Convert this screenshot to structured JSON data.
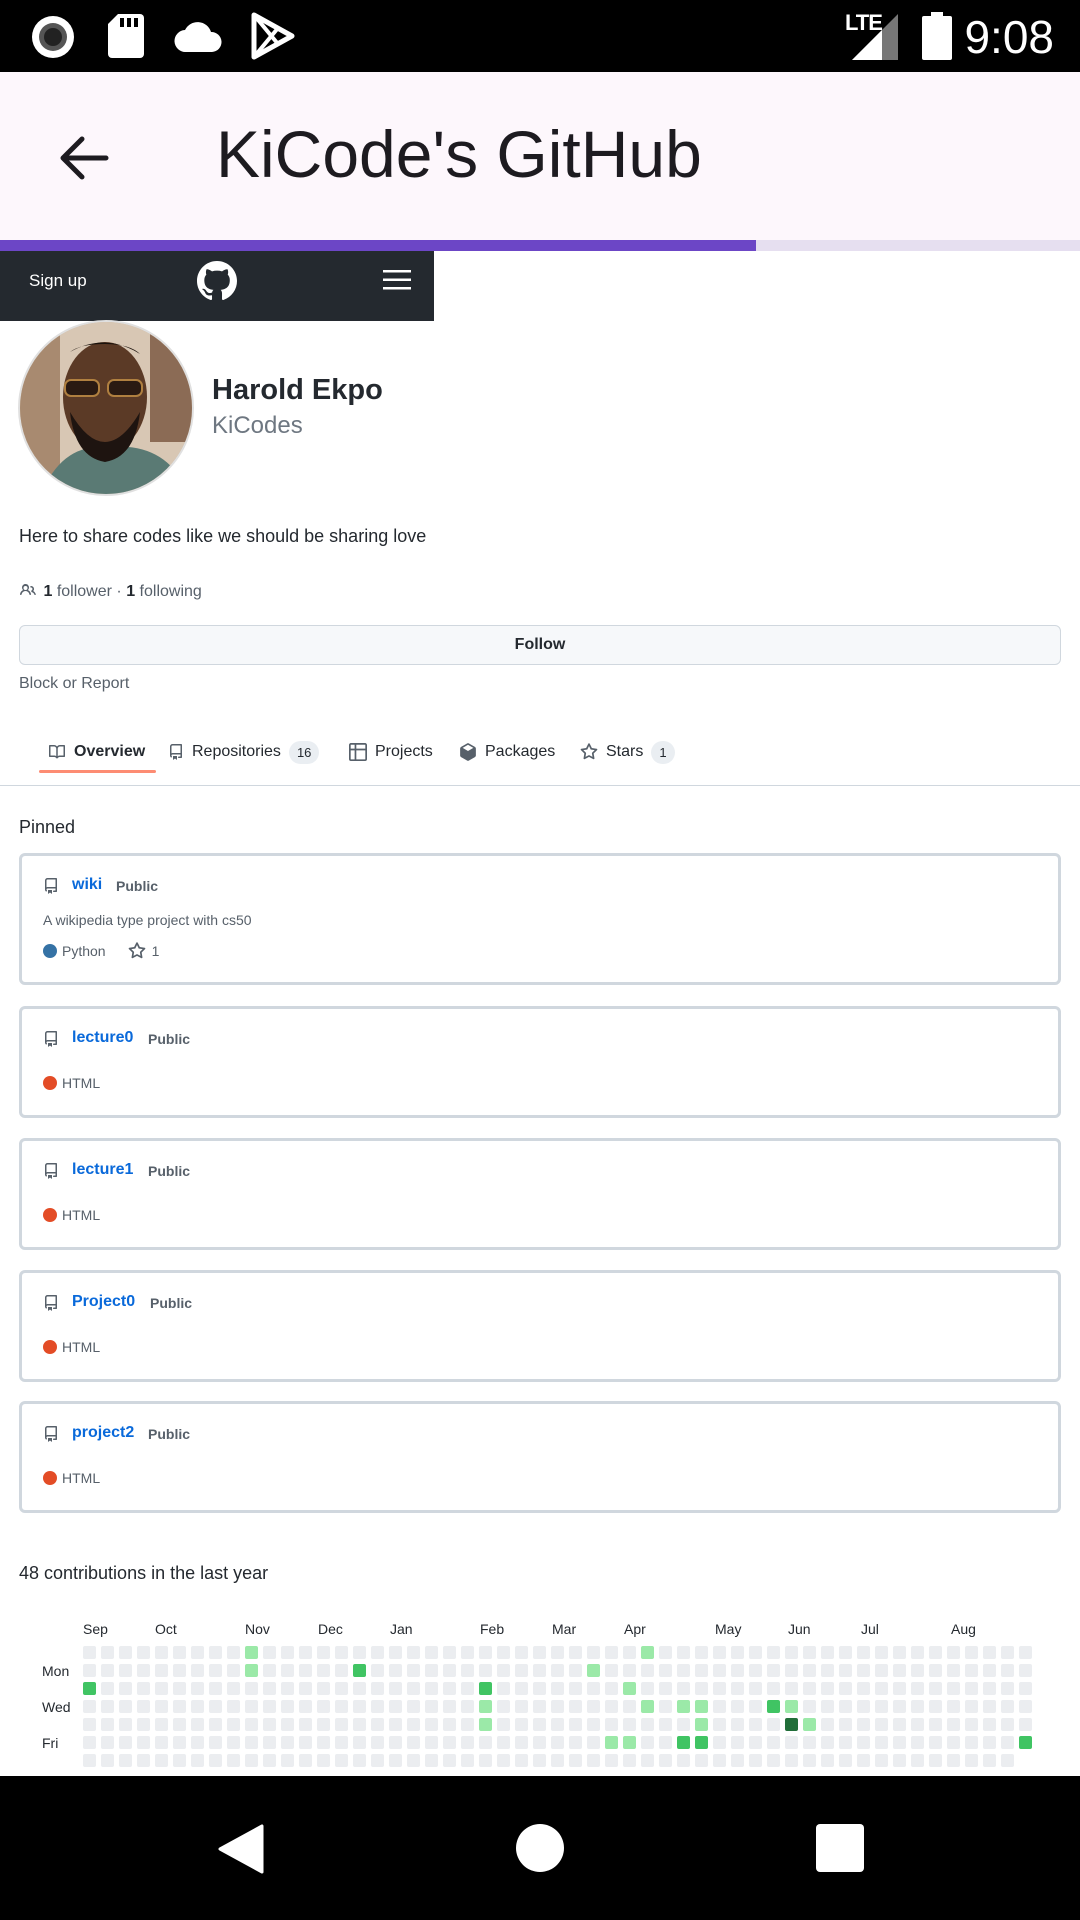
{
  "status_bar": {
    "time": "9:08",
    "network": "LTE",
    "icons": [
      "record-icon",
      "sd-card-icon",
      "cloud-icon",
      "play-store-icon",
      "lte-signal-icon",
      "battery-icon"
    ]
  },
  "app_bar": {
    "title": "KiCode's GitHub",
    "back_icon": "arrow-back-icon"
  },
  "page_load_progress": 0.7,
  "gh_header": {
    "signup_label": "Sign up",
    "logo_icon": "github-icon",
    "menu_icon": "hamburger-icon"
  },
  "profile": {
    "name": "Harold Ekpo",
    "login": "KiCodes",
    "bio": "Here to share codes like we should be sharing love",
    "followers_count": "1",
    "followers_label": "follower",
    "separator": "·",
    "following_count": "1",
    "following_label": "following",
    "follow_label": "Follow",
    "block_label": "Block or Report"
  },
  "tabs": [
    {
      "label": "Overview",
      "icon": "book-icon",
      "counter": null
    },
    {
      "label": "Repositories",
      "icon": "repo-icon",
      "counter": "16"
    },
    {
      "label": "Projects",
      "icon": "table-icon",
      "counter": null
    },
    {
      "label": "Packages",
      "icon": "package-icon",
      "counter": null
    },
    {
      "label": "Stars",
      "icon": "star-icon",
      "counter": "1"
    }
  ],
  "pinned": {
    "heading": "Pinned",
    "repos": [
      {
        "name": "wiki",
        "visibility": "Public",
        "description": "A wikipedia type project with cs50",
        "language": "Python",
        "language_color": "#3572A5",
        "stars": "1"
      },
      {
        "name": "lecture0",
        "visibility": "Public",
        "description": "",
        "language": "HTML",
        "language_color": "#e34c26",
        "stars": null
      },
      {
        "name": "lecture1",
        "visibility": "Public",
        "description": "",
        "language": "HTML",
        "language_color": "#e34c26",
        "stars": null
      },
      {
        "name": "Project0",
        "visibility": "Public",
        "description": "",
        "language": "HTML",
        "language_color": "#e34c26",
        "stars": null
      },
      {
        "name": "project2",
        "visibility": "Public",
        "description": "",
        "language": "HTML",
        "language_color": "#e34c26",
        "stars": null
      }
    ]
  },
  "contributions": {
    "heading": "48 contributions in the last year",
    "months": [
      "Sep",
      "Oct",
      "Nov",
      "Dec",
      "Jan",
      "Feb",
      "Mar",
      "Apr",
      "May",
      "Jun",
      "Jul",
      "Aug"
    ],
    "days": [
      "Mon",
      "Wed",
      "Fri"
    ],
    "colors": [
      "#ebedf0",
      "#9be9a8",
      "#40c463",
      "#30a14e",
      "#216e39"
    ],
    "active_cells": [
      {
        "week": 9,
        "day": 0,
        "level": 1
      },
      {
        "week": 9,
        "day": 1,
        "level": 1
      },
      {
        "week": 0,
        "day": 2,
        "level": 2
      },
      {
        "week": 15,
        "day": 1,
        "level": 2
      },
      {
        "week": 22,
        "day": 2,
        "level": 2
      },
      {
        "week": 22,
        "day": 3,
        "level": 1
      },
      {
        "week": 22,
        "day": 4,
        "level": 1
      },
      {
        "week": 28,
        "day": 1,
        "level": 1
      },
      {
        "week": 29,
        "day": 5,
        "level": 1
      },
      {
        "week": 30,
        "day": 2,
        "level": 1
      },
      {
        "week": 30,
        "day": 5,
        "level": 1
      },
      {
        "week": 31,
        "day": 0,
        "level": 1
      },
      {
        "week": 31,
        "day": 3,
        "level": 1
      },
      {
        "week": 33,
        "day": 3,
        "level": 1
      },
      {
        "week": 33,
        "day": 5,
        "level": 2
      },
      {
        "week": 34,
        "day": 3,
        "level": 1
      },
      {
        "week": 34,
        "day": 4,
        "level": 1
      },
      {
        "week": 34,
        "day": 5,
        "level": 2
      },
      {
        "week": 38,
        "day": 3,
        "level": 2
      },
      {
        "week": 39,
        "day": 4,
        "level": 4
      },
      {
        "week": 39,
        "day": 3,
        "level": 1
      },
      {
        "week": 40,
        "day": 4,
        "level": 1
      },
      {
        "week": 52,
        "day": 5,
        "level": 2
      }
    ]
  },
  "nav_bar": {
    "icons": [
      "back-triangle-icon",
      "home-circle-icon",
      "recents-square-icon"
    ]
  }
}
